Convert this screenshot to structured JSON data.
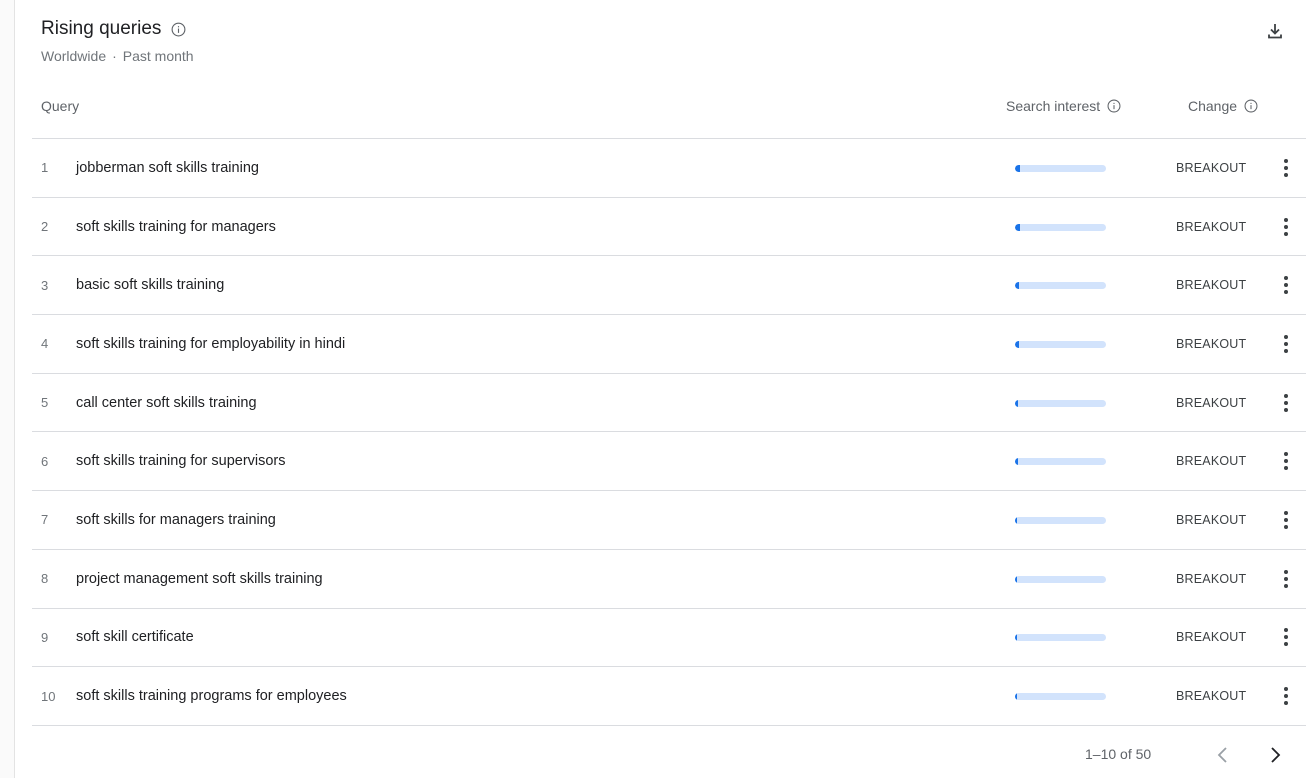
{
  "header": {
    "title": "Rising queries",
    "subtitle_region": "Worldwide",
    "subtitle_separator": "·",
    "subtitle_period": "Past month"
  },
  "columns": {
    "query": "Query",
    "search_interest": "Search interest",
    "change": "Change"
  },
  "rows": [
    {
      "rank": "1",
      "query": "jobberman soft skills training",
      "interest": 0.05,
      "change": "BREAKOUT"
    },
    {
      "rank": "2",
      "query": "soft skills training for managers",
      "interest": 0.05,
      "change": "BREAKOUT"
    },
    {
      "rank": "3",
      "query": "basic soft skills training",
      "interest": 0.04,
      "change": "BREAKOUT"
    },
    {
      "rank": "4",
      "query": "soft skills training for employability in hindi",
      "interest": 0.04,
      "change": "BREAKOUT"
    },
    {
      "rank": "5",
      "query": "call center soft skills training",
      "interest": 0.03,
      "change": "BREAKOUT"
    },
    {
      "rank": "6",
      "query": "soft skills training for supervisors",
      "interest": 0.03,
      "change": "BREAKOUT"
    },
    {
      "rank": "7",
      "query": "soft skills for managers training",
      "interest": 0.02,
      "change": "BREAKOUT"
    },
    {
      "rank": "8",
      "query": "project management soft skills training",
      "interest": 0.02,
      "change": "BREAKOUT"
    },
    {
      "rank": "9",
      "query": "soft skill certificate",
      "interest": 0.02,
      "change": "BREAKOUT"
    },
    {
      "rank": "10",
      "query": "soft skills training programs for employees",
      "interest": 0.02,
      "change": "BREAKOUT"
    }
  ],
  "pagination": {
    "label": "1–10 of 50"
  },
  "icons": {
    "info": "info-icon",
    "download": "download-icon",
    "menu": "more-vert-icon",
    "prev": "chevron-left-icon",
    "next": "chevron-right-icon"
  },
  "colors": {
    "bar_track": "#d2e3fc",
    "bar_fill": "#1a73e8"
  }
}
